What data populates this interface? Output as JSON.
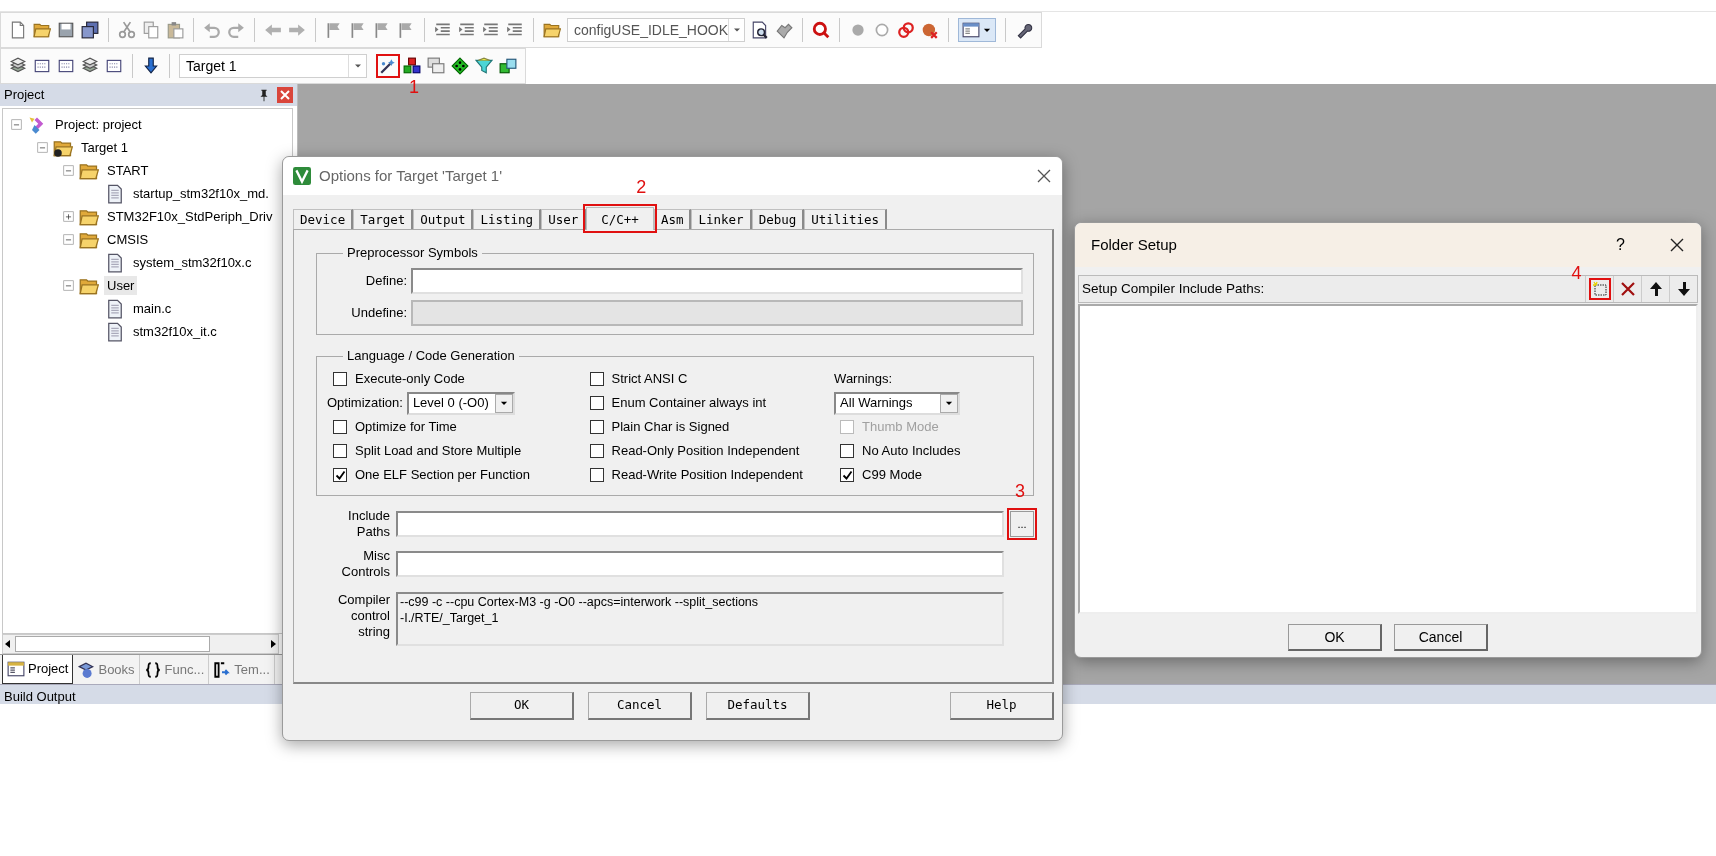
{
  "toolbar": {
    "combo_value": "configUSE_IDLE_HOOK"
  },
  "build_toolbar": {
    "target": "Target 1"
  },
  "project_panel": {
    "title": "Project",
    "tree": [
      {
        "label": "Project: project",
        "kind": "project",
        "expanded": true,
        "selected": false,
        "children": [
          {
            "label": "Target 1",
            "kind": "target",
            "expanded": true,
            "selected": false,
            "children": [
              {
                "label": "START",
                "kind": "group",
                "expanded": true,
                "selected": false,
                "children": [
                  {
                    "label": "startup_stm32f10x_md.",
                    "kind": "file",
                    "selected": false
                  }
                ]
              },
              {
                "label": "STM32F10x_StdPeriph_Driv",
                "kind": "group",
                "expanded": false,
                "selected": false
              },
              {
                "label": "CMSIS",
                "kind": "group",
                "expanded": true,
                "selected": false,
                "children": [
                  {
                    "label": "system_stm32f10x.c",
                    "kind": "file",
                    "selected": false
                  }
                ]
              },
              {
                "label": "User",
                "kind": "group",
                "expanded": true,
                "selected": true,
                "children": [
                  {
                    "label": "main.c",
                    "kind": "file",
                    "selected": false
                  },
                  {
                    "label": "stm32f10x_it.c",
                    "kind": "file",
                    "selected": false
                  }
                ]
              }
            ]
          }
        ]
      }
    ],
    "tabs": [
      {
        "label": "Project",
        "kind": "project",
        "selected": true
      },
      {
        "label": "Books",
        "kind": "books",
        "selected": false
      },
      {
        "label": "Func...",
        "kind": "functions",
        "selected": false
      },
      {
        "label": "Tem...",
        "kind": "templates",
        "selected": false
      }
    ]
  },
  "build_output": {
    "title": "Build Output"
  },
  "options_dialog": {
    "title": "Options for Target 'Target 1'",
    "tabs": [
      {
        "label": "Device",
        "selected": false
      },
      {
        "label": "Target",
        "selected": false
      },
      {
        "label": "Output",
        "selected": false
      },
      {
        "label": "Listing",
        "selected": false
      },
      {
        "label": "User",
        "selected": false
      },
      {
        "label": "C/C++",
        "selected": true
      },
      {
        "label": "Asm",
        "selected": false
      },
      {
        "label": "Linker",
        "selected": false
      },
      {
        "label": "Debug",
        "selected": false
      },
      {
        "label": "Utilities",
        "selected": false
      }
    ],
    "preprocessor": {
      "title": "Preprocessor Symbols",
      "fields": [
        {
          "label": "Define:",
          "disabled": false
        },
        {
          "label": "Undefine:",
          "disabled": true
        }
      ]
    },
    "language": {
      "title": "Language / Code Generation",
      "columns": [
        [
          {
            "kind": "checkbox",
            "label": "Execute-only Code",
            "checked": false,
            "disabled": false
          },
          {
            "kind": "select",
            "label": "Optimization:",
            "value": "Level 0 (-O0)"
          },
          {
            "kind": "checkbox",
            "label": "Optimize for Time",
            "checked": false,
            "disabled": false
          },
          {
            "kind": "checkbox",
            "label": "Split Load and Store Multiple",
            "checked": false,
            "disabled": false
          },
          {
            "kind": "checkbox",
            "label": "One ELF Section per Function",
            "checked": true,
            "disabled": false
          }
        ],
        [
          {
            "kind": "checkbox",
            "label": "Strict ANSI C",
            "checked": false,
            "disabled": false
          },
          {
            "kind": "checkbox",
            "label": "Enum Container always int",
            "checked": false,
            "disabled": false
          },
          {
            "kind": "checkbox",
            "label": "Plain Char is Signed",
            "checked": false,
            "disabled": false
          },
          {
            "kind": "checkbox",
            "label": "Read-Only Position Independent",
            "checked": false,
            "disabled": false
          },
          {
            "kind": "checkbox",
            "label": "Read-Write Position Independent",
            "checked": false,
            "disabled": false
          }
        ],
        [
          {
            "kind": "caption",
            "label": "Warnings:"
          },
          {
            "kind": "select",
            "value": "All Warnings"
          },
          {
            "kind": "checkbox",
            "label": "Thumb Mode",
            "checked": false,
            "disabled": true
          },
          {
            "kind": "checkbox",
            "label": "No Auto Includes",
            "checked": false,
            "disabled": false
          },
          {
            "kind": "checkbox",
            "label": "C99 Mode",
            "checked": true,
            "disabled": false
          }
        ]
      ]
    },
    "paths": [
      {
        "label": "Include Paths",
        "kind": "browse",
        "browse_label": "..."
      },
      {
        "label": "Misc Controls",
        "kind": "plain"
      }
    ],
    "compiler": {
      "label": "Compiler control string",
      "lines": [
        "--c99 -c --cpu Cortex-M3 -g -O0 --apcs=interwork --split_sections",
        "-I./RTE/_Target_1"
      ]
    },
    "buttons": [
      "OK",
      "Cancel",
      "Defaults",
      "Help"
    ]
  },
  "folder_dialog": {
    "title": "Folder Setup",
    "help": "?",
    "list_title": "Setup Compiler Include Paths:",
    "buttons": [
      "OK",
      "Cancel"
    ]
  },
  "annotations": [
    {
      "label": "1"
    },
    {
      "label": "2"
    },
    {
      "label": "3"
    },
    {
      "label": "4"
    }
  ]
}
